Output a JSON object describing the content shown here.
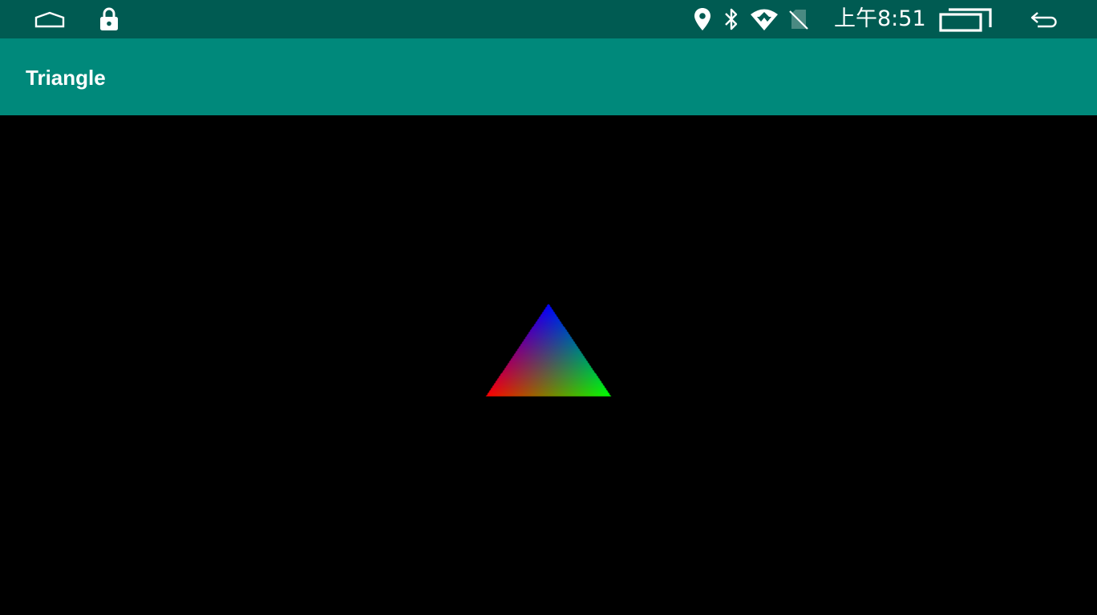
{
  "status_bar": {
    "background": "#005b52",
    "clock": "上午8:51",
    "icons": [
      "home-icon",
      "lock-icon",
      "location-icon",
      "bluetooth-icon",
      "wifi-icon",
      "no-sim-icon",
      "recent-apps-icon",
      "back-icon"
    ]
  },
  "app_bar": {
    "background": "#00897b",
    "title": "Triangle"
  },
  "content": {
    "background": "#000000",
    "triangle": {
      "vertex_colors": [
        "#0000ff",
        "#ff0000",
        "#00ff00"
      ]
    }
  }
}
